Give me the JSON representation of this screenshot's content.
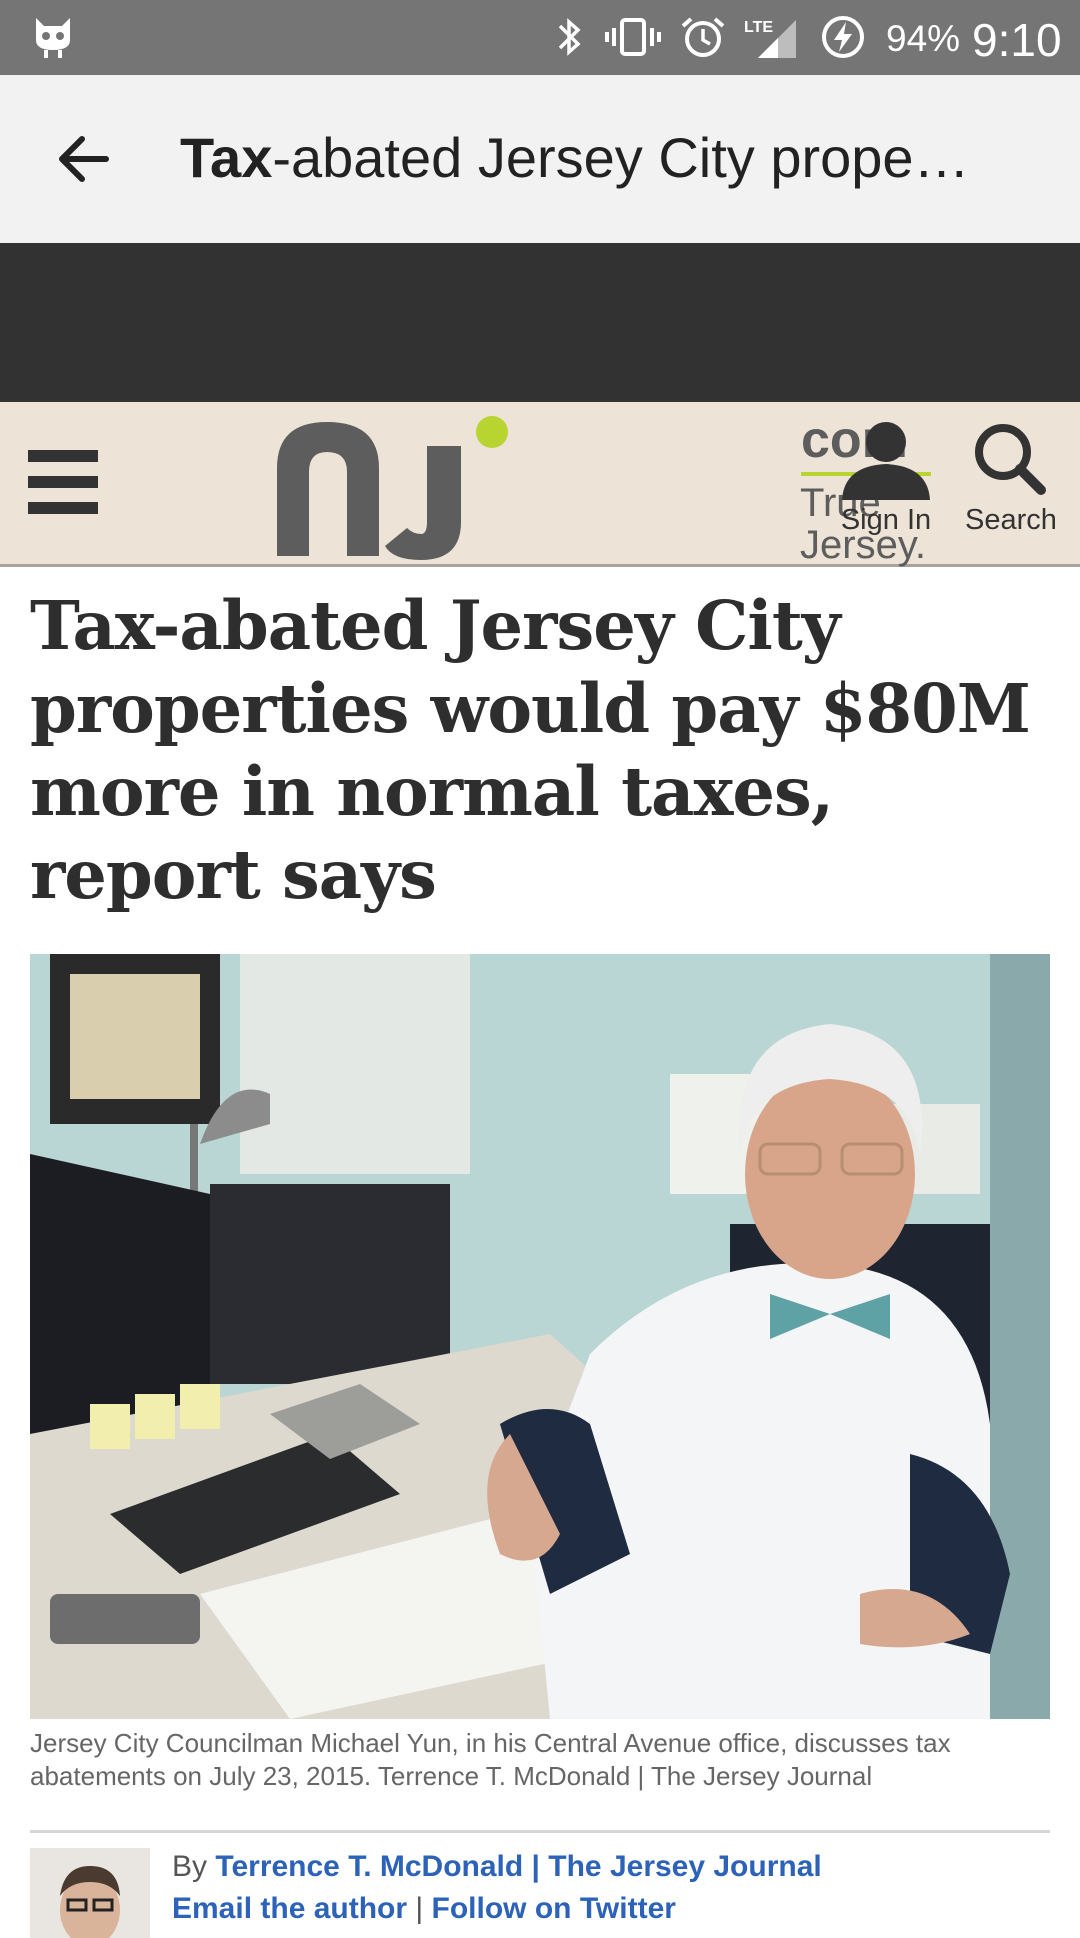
{
  "status_bar": {
    "battery": "94%",
    "time": "9:10",
    "network": "LTE"
  },
  "app_bar": {
    "title_bold": "Tax",
    "title_rest": "-abated Jersey City prope…"
  },
  "site_header": {
    "logo_com": "com",
    "logo_tagline_1": "True",
    "logo_tagline_2": "Jersey.",
    "signin_label": "Sign In",
    "search_label": "Search",
    "colors": {
      "accent_green": "#b8d431",
      "logo_gray": "#5d5d5d",
      "background": "#ede3d6"
    }
  },
  "article": {
    "headline": "Tax-abated Jersey City properties would pay $80M more in normal taxes, report says",
    "caption": "Jersey City Councilman Michael Yun, in his Central Avenue office, discusses tax abatements on July 23, 2015. Terrence T. McDonald | The Jersey Journal",
    "byline_prefix": "By",
    "author_link": "Terrence T. McDonald | The Jersey Journal",
    "email_link": "Email the author",
    "separator": "|",
    "twitter_link": "Follow on Twitter"
  }
}
